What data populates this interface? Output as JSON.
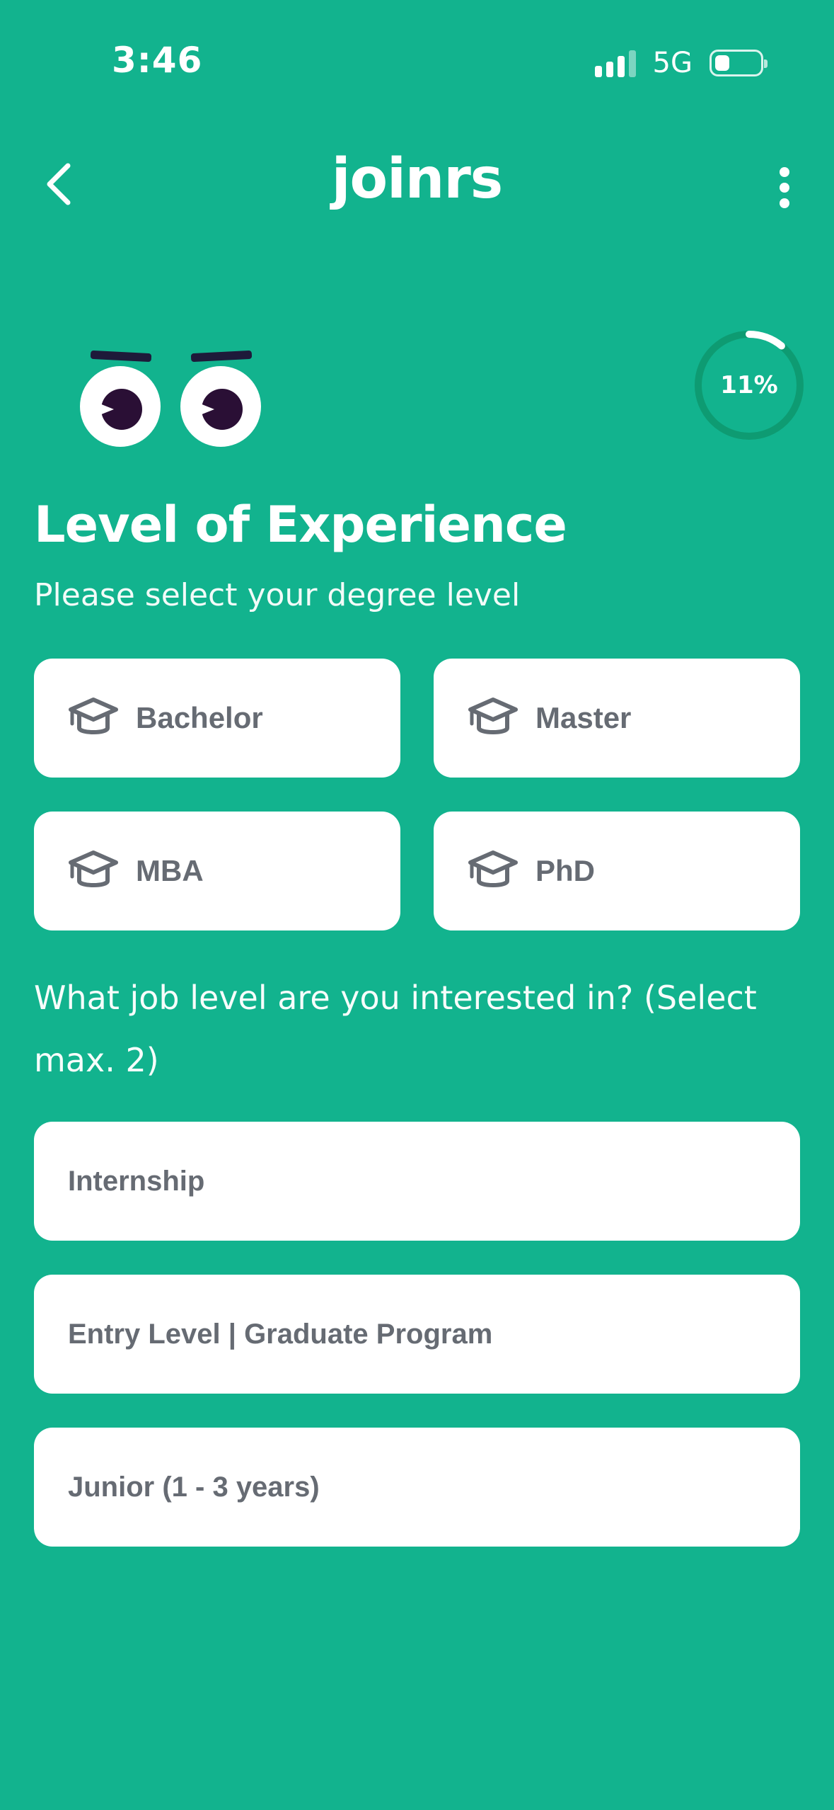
{
  "status_bar": {
    "time": "3:46",
    "network": "5G"
  },
  "header": {
    "brand": "joinrs",
    "back_icon": "chevron-left-icon",
    "menu_icon": "vertical-ellipsis-icon"
  },
  "progress": {
    "label": "11%",
    "value": 0.11
  },
  "page": {
    "title": "Level of Experience",
    "subtitle": "Please select your degree level"
  },
  "degrees": [
    {
      "label": "Bachelor",
      "icon": "graduation-cap-icon"
    },
    {
      "label": "Master",
      "icon": "graduation-cap-icon"
    },
    {
      "label": "MBA",
      "icon": "graduation-cap-icon"
    },
    {
      "label": "PhD",
      "icon": "graduation-cap-icon"
    }
  ],
  "job_question": "What job level are you interested in? (Select max. 2)",
  "job_levels": [
    {
      "label": "Internship"
    },
    {
      "label": "Entry Level | Graduate Program"
    },
    {
      "label": "Junior (1 - 3 years)"
    }
  ],
  "colors": {
    "background": "#12B38E",
    "card": "#FFFFFF",
    "card_text": "#666B73",
    "ring_track": "#0E9B72",
    "ring_progress": "#FFFFFF",
    "pupil": "#2A0F35"
  }
}
